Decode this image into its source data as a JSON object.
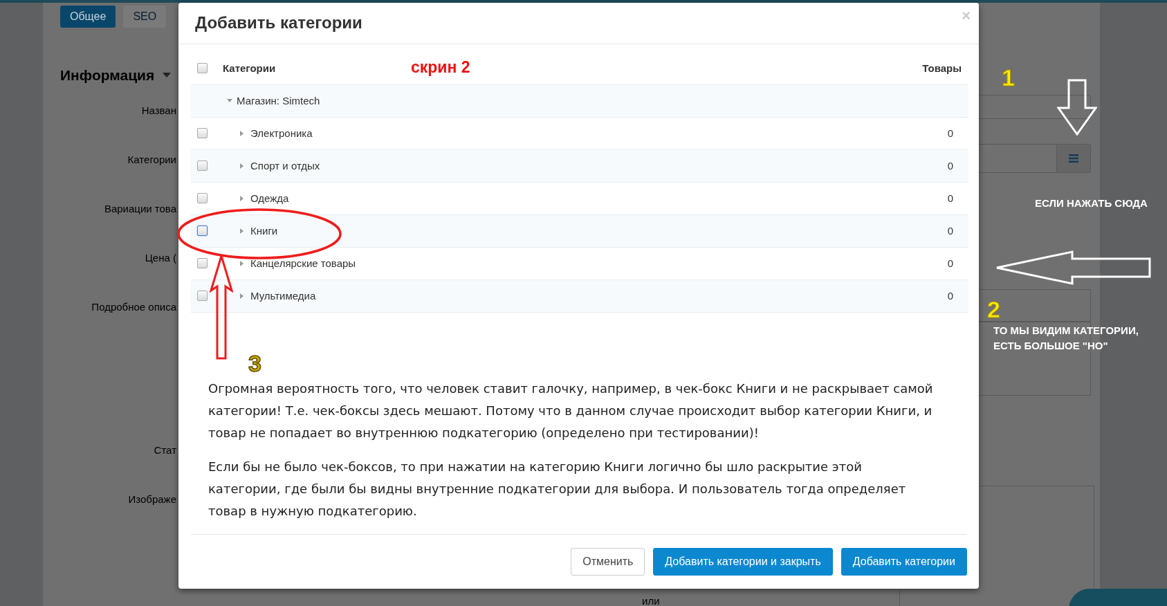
{
  "page": {
    "tabs": [
      {
        "label": "Общее",
        "selected": true
      },
      {
        "label": "SEO",
        "selected": false
      }
    ],
    "section_title": "Информация",
    "field_labels": [
      "Назван",
      "Категории",
      "Вариации това",
      "Цена (",
      "Подробное описа",
      "Стат",
      "Изображе"
    ],
    "footer_text": "или"
  },
  "dialog": {
    "title": "Добавить категории",
    "close": "×",
    "columns": [
      "Категории",
      "Товары"
    ],
    "select_all": {
      "checked": false
    },
    "tree": {
      "name": "Магазин: Simtech",
      "expanded": true,
      "children": [
        {
          "name": "Электроника",
          "count": "0",
          "checked": false,
          "focused": false
        },
        {
          "name": "Спорт и отдых",
          "count": "0",
          "checked": false,
          "focused": false
        },
        {
          "name": "Одежда",
          "count": "0",
          "checked": false,
          "focused": false
        },
        {
          "name": "Книги",
          "count": "0",
          "checked": false,
          "focused": true
        },
        {
          "name": "Канцелярские товары",
          "count": "0",
          "checked": false,
          "focused": false
        },
        {
          "name": "Мультимедиа",
          "count": "0",
          "checked": false,
          "focused": false
        }
      ]
    },
    "paragraphs": [
      "Огромная вероятность того, что человек ставит галочку, например, в чек-бокс Книги и не раскрывает самой категории! Т.е. чек-боксы здесь мешают. Потому что в данном случае происходит выбор категории Книги, и товар не попадает во внутреннюю подкатегорию (определено при тестировании)!",
      "Если бы не было чек-боксов, то при нажатии на категорию Книги логично бы шло раскрытие этой категории, где были бы видны внутренние подкатегории для выбора. И пользователь тогда определяет товар в нужную подкатегорию."
    ],
    "buttons": [
      {
        "label": "Отменить",
        "kind": "secondary"
      },
      {
        "label": "Добавить категории и закрыть",
        "kind": "primary"
      },
      {
        "label": "Добавить категории",
        "kind": "primary"
      }
    ]
  },
  "annotations": {
    "screen_label": "скрин 2",
    "numbers": [
      "1",
      "2",
      "3"
    ],
    "captions": [
      "ЕСЛИ НАЖАТЬ СЮДА",
      "ТО МЫ ВИДИМ КАТЕГОРИИ, ЕСТЬ БОЛЬШОЕ \"НО\""
    ]
  }
}
